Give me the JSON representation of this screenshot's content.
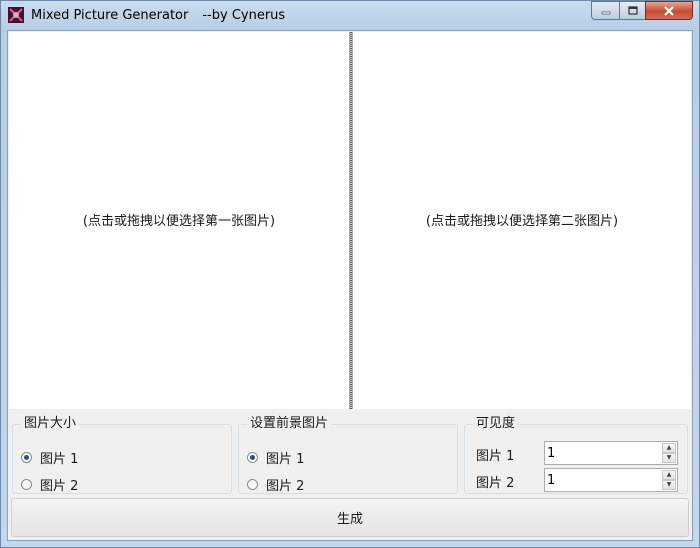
{
  "window": {
    "title": "Mixed Picture Generator",
    "author": "--by Cynerus",
    "icons": {
      "app": "app-logo-icon",
      "minimize": "minimize-icon",
      "maximize": "maximize-icon",
      "close": "close-icon"
    }
  },
  "picture_area": {
    "first_hint": "(点击或拖拽以便选择第一张图片)",
    "second_hint": "(点击或拖拽以便选择第二张图片)"
  },
  "size_group": {
    "title": "图片大小",
    "options": [
      {
        "label": "图片 1",
        "checked": true
      },
      {
        "label": "图片 2",
        "checked": false
      }
    ]
  },
  "foreground_group": {
    "title": "设置前景图片",
    "options": [
      {
        "label": "图片 1",
        "checked": true
      },
      {
        "label": "图片 2",
        "checked": false
      }
    ]
  },
  "visibility_group": {
    "title": "可见度",
    "rows": [
      {
        "label": "图片 1",
        "value": "1"
      },
      {
        "label": "图片 2",
        "value": "1"
      }
    ]
  },
  "generate_button": {
    "label": "生成"
  },
  "colors": {
    "title_bar": "#bcd1e8",
    "close_button": "#c64b32",
    "client_bg": "#f0f0f0"
  }
}
